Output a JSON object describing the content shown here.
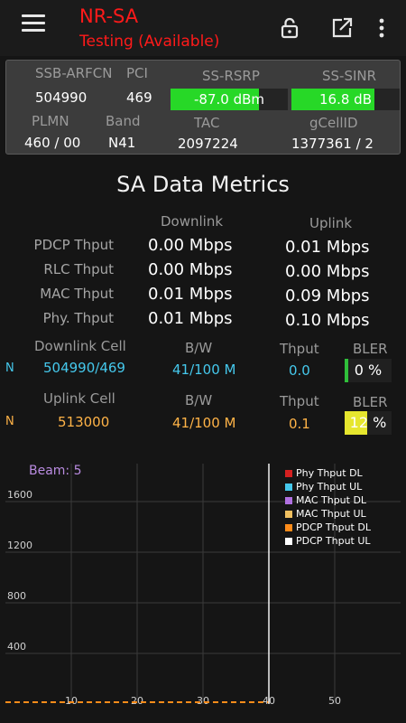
{
  "app": {
    "title": "NR-SA",
    "status": "Testing (Available)"
  },
  "colors": {
    "accent_red": "#ff1a1a",
    "meter_green": "#27d827",
    "downlink_cyan": "#45c8ec",
    "uplink_orange": "#ffb347",
    "bler_low": "#2fbf3a",
    "bler_mid": "#e6e62e",
    "beam_purple": "#b98be0"
  },
  "icons": {
    "menu": "hamburger-menu-icon",
    "lock": "lock-icon",
    "share": "open-external-icon",
    "more": "more-vertical-icon"
  },
  "info": {
    "ssb_arfcn_label": "SSB-ARFCN",
    "ssb_arfcn": "504990",
    "pci_label": "PCI",
    "pci": "469",
    "rsrp_label": "SS-RSRP",
    "rsrp": "-87.0 dBm",
    "rsrp_level": 0.75,
    "sinr_label": "SS-SINR",
    "sinr": "16.8 dB",
    "sinr_level": 0.77,
    "plmn_label": "PLMN",
    "plmn": "460 / 00",
    "band_label": "Band",
    "band": "N41",
    "tac_label": "TAC",
    "tac": "2097224",
    "gcellid_label": "gCellID",
    "gcellid": "1377361 / 2"
  },
  "metrics": {
    "title": "SA Data Metrics",
    "downlink_header": "Downlink",
    "uplink_header": "Uplink",
    "rows": [
      {
        "label": "PDCP Thput",
        "dl": "0.00 Mbps",
        "ul": "0.01 Mbps"
      },
      {
        "label": "RLC Thput",
        "dl": "0.00 Mbps",
        "ul": "0.00 Mbps"
      },
      {
        "label": "MAC Thput",
        "dl": "0.01 Mbps",
        "ul": "0.09 Mbps"
      },
      {
        "label": "Phy. Thput",
        "dl": "0.01 Mbps",
        "ul": "0.10 Mbps"
      }
    ]
  },
  "cells": {
    "downlink": {
      "indicator": "N",
      "label": "Downlink Cell",
      "bw_label": "B/W",
      "thput_label": "Thput",
      "bler_label": "BLER",
      "cell": "504990/469",
      "bw": "41/100 M",
      "thput": "0.0",
      "bler": "0 %",
      "bler_level": 0.0
    },
    "uplink": {
      "indicator": "N",
      "label": "Uplink Cell",
      "bw_label": "B/W",
      "thput_label": "Thput",
      "bler_label": "BLER",
      "cell": "513000",
      "bw": "41/100 M",
      "thput": "0.1",
      "bler": "12 %",
      "bler_level": 0.12
    }
  },
  "chart_data": {
    "type": "line",
    "title": "Beam: 5",
    "x_ticks": [
      10,
      20,
      30,
      40,
      50
    ],
    "y_ticks": [
      400,
      800,
      1200,
      1600
    ],
    "xlim": [
      0,
      60
    ],
    "ylim": [
      0,
      1900
    ],
    "grid": true,
    "legend_position": "top-right",
    "series": [
      {
        "name": "Phy Thput DL",
        "color": "#d42020",
        "values": []
      },
      {
        "name": "Phy Thput UL",
        "color": "#45c8ec",
        "values": []
      },
      {
        "name": "MAC Thput DL",
        "color": "#b070e0",
        "values": []
      },
      {
        "name": "MAC Thput UL",
        "color": "#f0c060",
        "values": []
      },
      {
        "name": "PDCP Thput DL",
        "color": "#ff8c1a",
        "values": []
      },
      {
        "name": "PDCP Thput UL",
        "color": "#ffffff",
        "values": []
      }
    ],
    "cursor_x": 40
  }
}
